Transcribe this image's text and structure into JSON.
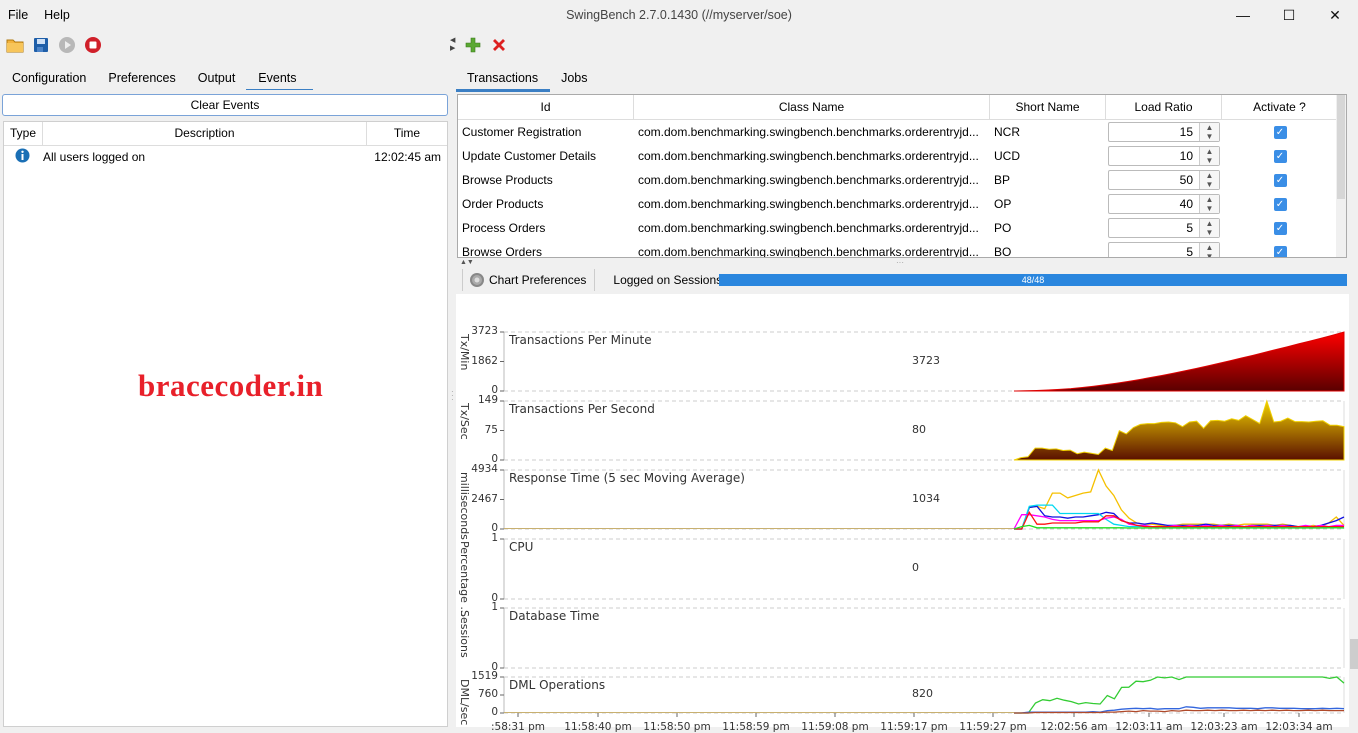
{
  "window": {
    "title": "SwingBench 2.7.0.1430  (//myserver/soe)",
    "menu": [
      "File",
      "Help"
    ],
    "controls": {
      "minimize": "—",
      "maximize": "☐",
      "close": "✕"
    }
  },
  "toolbar_left": {
    "icons": [
      "open-folder-icon",
      "save-icon",
      "start-icon",
      "stop-icon"
    ]
  },
  "toolbar_right": {
    "icons": [
      "add-icon",
      "delete-icon"
    ]
  },
  "left_tabs": [
    {
      "label": "Configuration",
      "active": false
    },
    {
      "label": "Preferences",
      "active": false
    },
    {
      "label": "Output",
      "active": false
    },
    {
      "label": "Events",
      "active": true
    }
  ],
  "right_tabs": [
    {
      "label": "Transactions",
      "active": true
    },
    {
      "label": "Jobs",
      "active": false
    }
  ],
  "events": {
    "clear_label": "Clear Events",
    "columns": [
      "Type",
      "Description",
      "Time"
    ],
    "rows": [
      {
        "type": "info",
        "description": "All users logged on",
        "time": "12:02:45 am"
      }
    ]
  },
  "watermark": "bracecoder.in",
  "transactions": {
    "columns": [
      "Id",
      "Class Name",
      "Short Name",
      "Load Ratio",
      "Activate ?"
    ],
    "rows": [
      {
        "id": "Customer Registration",
        "class": "com.dom.benchmarking.swingbench.benchmarks.orderentryjd...",
        "short": "NCR",
        "ratio": "15",
        "active": true
      },
      {
        "id": "Update Customer Details",
        "class": "com.dom.benchmarking.swingbench.benchmarks.orderentryjd...",
        "short": "UCD",
        "ratio": "10",
        "active": true
      },
      {
        "id": "Browse Products",
        "class": "com.dom.benchmarking.swingbench.benchmarks.orderentryjd...",
        "short": "BP",
        "ratio": "50",
        "active": true
      },
      {
        "id": "Order Products",
        "class": "com.dom.benchmarking.swingbench.benchmarks.orderentryjd...",
        "short": "OP",
        "ratio": "40",
        "active": true
      },
      {
        "id": "Process Orders",
        "class": "com.dom.benchmarking.swingbench.benchmarks.orderentryjd...",
        "short": "PO",
        "ratio": "5",
        "active": true
      },
      {
        "id": "Browse Orders",
        "class": "com.dom.benchmarking.swingbench.benchmarks.orderentryjd...",
        "short": "BO",
        "ratio": "5",
        "active": true
      }
    ]
  },
  "chart_toolbar": {
    "prefs_label": "Chart Preferences",
    "sessions_label": "Logged on Sessions",
    "sessions_progress": "48/48",
    "sessions_fraction": 1.0
  },
  "chart_data": [
    {
      "type": "area",
      "title": "Transactions Per Minute",
      "ylabel": "Tx/Min",
      "yticks": [
        "3723",
        "1862",
        "0"
      ],
      "ylim": [
        0,
        3723
      ],
      "current": "3723",
      "values": [
        0,
        10,
        30,
        60,
        100,
        150,
        220,
        300,
        390,
        490,
        600,
        720,
        850,
        980,
        1120,
        1270,
        1420,
        1580,
        1740,
        1910,
        2080,
        2250,
        2430,
        2610,
        2790,
        2970,
        3150,
        3330,
        3520,
        3723
      ]
    },
    {
      "type": "area",
      "title": "Transactions Per Second",
      "ylabel": "Tx/Sec",
      "yticks": [
        "149",
        "75",
        "0"
      ],
      "ylim": [
        0,
        149
      ],
      "current": "80",
      "values": [
        0,
        6,
        8,
        30,
        30,
        27,
        28,
        24,
        25,
        16,
        20,
        17,
        14,
        30,
        24,
        74,
        66,
        82,
        90,
        92,
        92,
        95,
        96,
        94,
        84,
        96,
        98,
        80,
        99,
        100,
        98,
        104,
        100,
        112,
        102,
        92,
        149,
        96,
        98,
        106,
        97,
        97,
        96,
        98,
        99,
        88,
        88,
        84
      ]
    },
    {
      "type": "line",
      "title": "Response Time (5 sec Moving Average)",
      "ylabel": "milliseconds",
      "yticks": [
        "4934",
        "2467",
        "0"
      ],
      "ylim": [
        0,
        4934
      ],
      "current": "1034",
      "series": [
        {
          "name": "s1",
          "color": "#f5c000",
          "values": [
            0,
            0,
            1800,
            1900,
            1700,
            3000,
            3000,
            2600,
            2800,
            3000,
            3100,
            4934,
            3600,
            2800,
            1600,
            900,
            500,
            400,
            400,
            300,
            200,
            300,
            400,
            400,
            400,
            400,
            400,
            300,
            400,
            300,
            400,
            400,
            400,
            400,
            300,
            400,
            300,
            200,
            200,
            300,
            200,
            500,
            1000,
            300
          ]
        },
        {
          "name": "s2",
          "color": "#1010e0",
          "values": [
            0,
            0,
            1800,
            1900,
            1100,
            1000,
            1000,
            900,
            1000,
            1000,
            1100,
            1200,
            1400,
            1300,
            700,
            500,
            500,
            400,
            500,
            400,
            300,
            300,
            300,
            300,
            300,
            400,
            300,
            300,
            300,
            300,
            200,
            300,
            300,
            300,
            300,
            300,
            300,
            200,
            200,
            200,
            300,
            500,
            700,
            1000
          ]
        },
        {
          "name": "s3",
          "color": "#00d8f0",
          "values": [
            0,
            0,
            1900,
            2000,
            2000,
            2000,
            1300,
            1300,
            1300,
            1300,
            1300,
            1300,
            800,
            400,
            300,
            200,
            200,
            200,
            200,
            150,
            150,
            150,
            150,
            150,
            150,
            150,
            150,
            150,
            150,
            150,
            150,
            150,
            150,
            150,
            150,
            150,
            150,
            150,
            150,
            100,
            100,
            100,
            100,
            100
          ]
        },
        {
          "name": "s4",
          "color": "#ff00ff",
          "values": [
            0,
            1200,
            1200,
            1100,
            1000,
            800,
            700,
            700,
            700,
            700,
            700,
            700,
            900,
            1000,
            800,
            400,
            300,
            300,
            200,
            200,
            200,
            300,
            200,
            300,
            200,
            300,
            200,
            300,
            200,
            300,
            200,
            300,
            200,
            300,
            200,
            300,
            200,
            200,
            300,
            200,
            300,
            200,
            300,
            300
          ]
        },
        {
          "name": "s5",
          "color": "#ff1010",
          "values": [
            0,
            0,
            1400,
            400,
            400,
            500,
            500,
            500,
            500,
            600,
            600,
            600,
            1100,
            1100,
            700,
            500,
            300,
            200,
            200,
            200,
            200,
            200,
            200,
            200,
            200,
            200,
            200,
            200,
            200,
            200,
            200,
            200,
            200,
            200,
            200,
            200,
            200,
            200,
            200,
            200,
            200,
            200,
            200,
            200
          ]
        },
        {
          "name": "s6",
          "color": "#20e020",
          "values": [
            0,
            200,
            300,
            100,
            100,
            100,
            100,
            100,
            100,
            100,
            100,
            100,
            100,
            100,
            100,
            80,
            80,
            80,
            80,
            80,
            80,
            80,
            80,
            80,
            80,
            80,
            80,
            80,
            80,
            80,
            80,
            80,
            80,
            80,
            80,
            80,
            80,
            80,
            80,
            80,
            80,
            100,
            100,
            80
          ]
        }
      ]
    },
    {
      "type": "line",
      "title": "CPU",
      "ylabel": "Percentage ...",
      "yticks": [
        "1",
        "0"
      ],
      "ylim": [
        0,
        1
      ],
      "current": "0",
      "series": []
    },
    {
      "type": "line",
      "title": "Database Time",
      "ylabel": "Sessions",
      "yticks": [
        "1",
        "0"
      ],
      "ylim": [
        0,
        1
      ],
      "current": "",
      "series": []
    },
    {
      "type": "line",
      "title": "DML Operations",
      "ylabel": "DML/sec",
      "yticks": [
        "1519",
        "760",
        "0"
      ],
      "ylim": [
        0,
        1519
      ],
      "current": "820",
      "series": [
        {
          "name": "green",
          "color": "#33cc33",
          "values": [
            0,
            0,
            0,
            420,
            560,
            520,
            620,
            540,
            480,
            380,
            440,
            400,
            380,
            740,
            600,
            1080,
            1090,
            1340,
            1320,
            1380,
            1560,
            1480,
            1530,
            1410,
            1730,
            1710,
            1640,
            1760,
            1650,
            1760,
            1710,
            1720,
            1760,
            1760,
            1640,
            1990,
            1650,
            1680,
            1750,
            1640,
            1560,
            1600,
            1680,
            1630,
            1460,
            1520,
            1260
          ]
        },
        {
          "name": "blue",
          "color": "#3366dd",
          "values": [
            0,
            0,
            40,
            40,
            40,
            40,
            40,
            40,
            40,
            40,
            40,
            60,
            40,
            100,
            120,
            160,
            180,
            200,
            180,
            200,
            160,
            180,
            180,
            180,
            260,
            240,
            200,
            220,
            220,
            220,
            220,
            200,
            200,
            200,
            180,
            220,
            220,
            200,
            200,
            200,
            180,
            180,
            180,
            200,
            180,
            200,
            180
          ]
        },
        {
          "name": "brown",
          "color": "#b04a2a",
          "values": [
            0,
            0,
            0,
            20,
            20,
            20,
            20,
            20,
            20,
            20,
            20,
            20,
            20,
            40,
            40,
            60,
            80,
            60,
            100,
            80,
            80,
            60,
            100,
            80,
            120,
            100,
            100,
            120,
            100,
            120,
            100,
            100,
            120,
            100,
            120,
            100,
            120,
            100,
            120,
            100,
            100,
            120,
            100,
            120,
            100,
            100,
            100
          ]
        }
      ]
    }
  ],
  "x_axis": {
    "ticks": [
      ":58:31 pm",
      "11:58:40 pm",
      "11:58:50 pm",
      "11:58:59 pm",
      "11:59:08 pm",
      "11:59:17 pm",
      "11:59:27 pm",
      "12:02:56 am",
      "12:03:11 am",
      "12:03:23 am",
      "12:03:34 am"
    ]
  }
}
